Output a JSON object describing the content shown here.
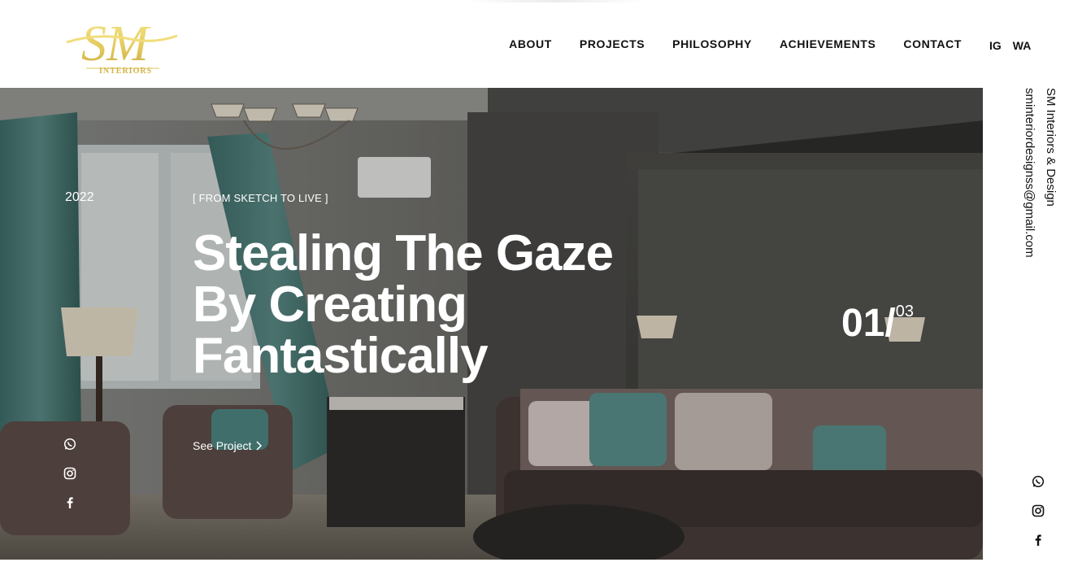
{
  "brand": {
    "logo_letters": "SM",
    "logo_sub": "INTERIORS",
    "gold": "#e2c75a"
  },
  "nav": {
    "items": [
      "ABOUT",
      "PROJECTS",
      "PHILOSOPHY",
      "ACHIEVEMENTS",
      "CONTACT"
    ],
    "social": [
      "IG",
      "WA"
    ]
  },
  "hero": {
    "year": "2022",
    "tagline": "[ FROM SKETCH TO LIVE ]",
    "headline_lines": [
      "Stealing The Gaze",
      "By Creating",
      "Fantastically"
    ],
    "cta": "See Project",
    "counter_current": "01/",
    "counter_total": "03",
    "social_icons": [
      "whatsapp-icon",
      "instagram-icon",
      "facebook-icon"
    ]
  },
  "side": {
    "company": "SM Interiors & Design",
    "email": "sminteriordesignss@gmail.com",
    "social_icons": [
      "whatsapp-icon",
      "instagram-icon",
      "facebook-icon"
    ]
  }
}
